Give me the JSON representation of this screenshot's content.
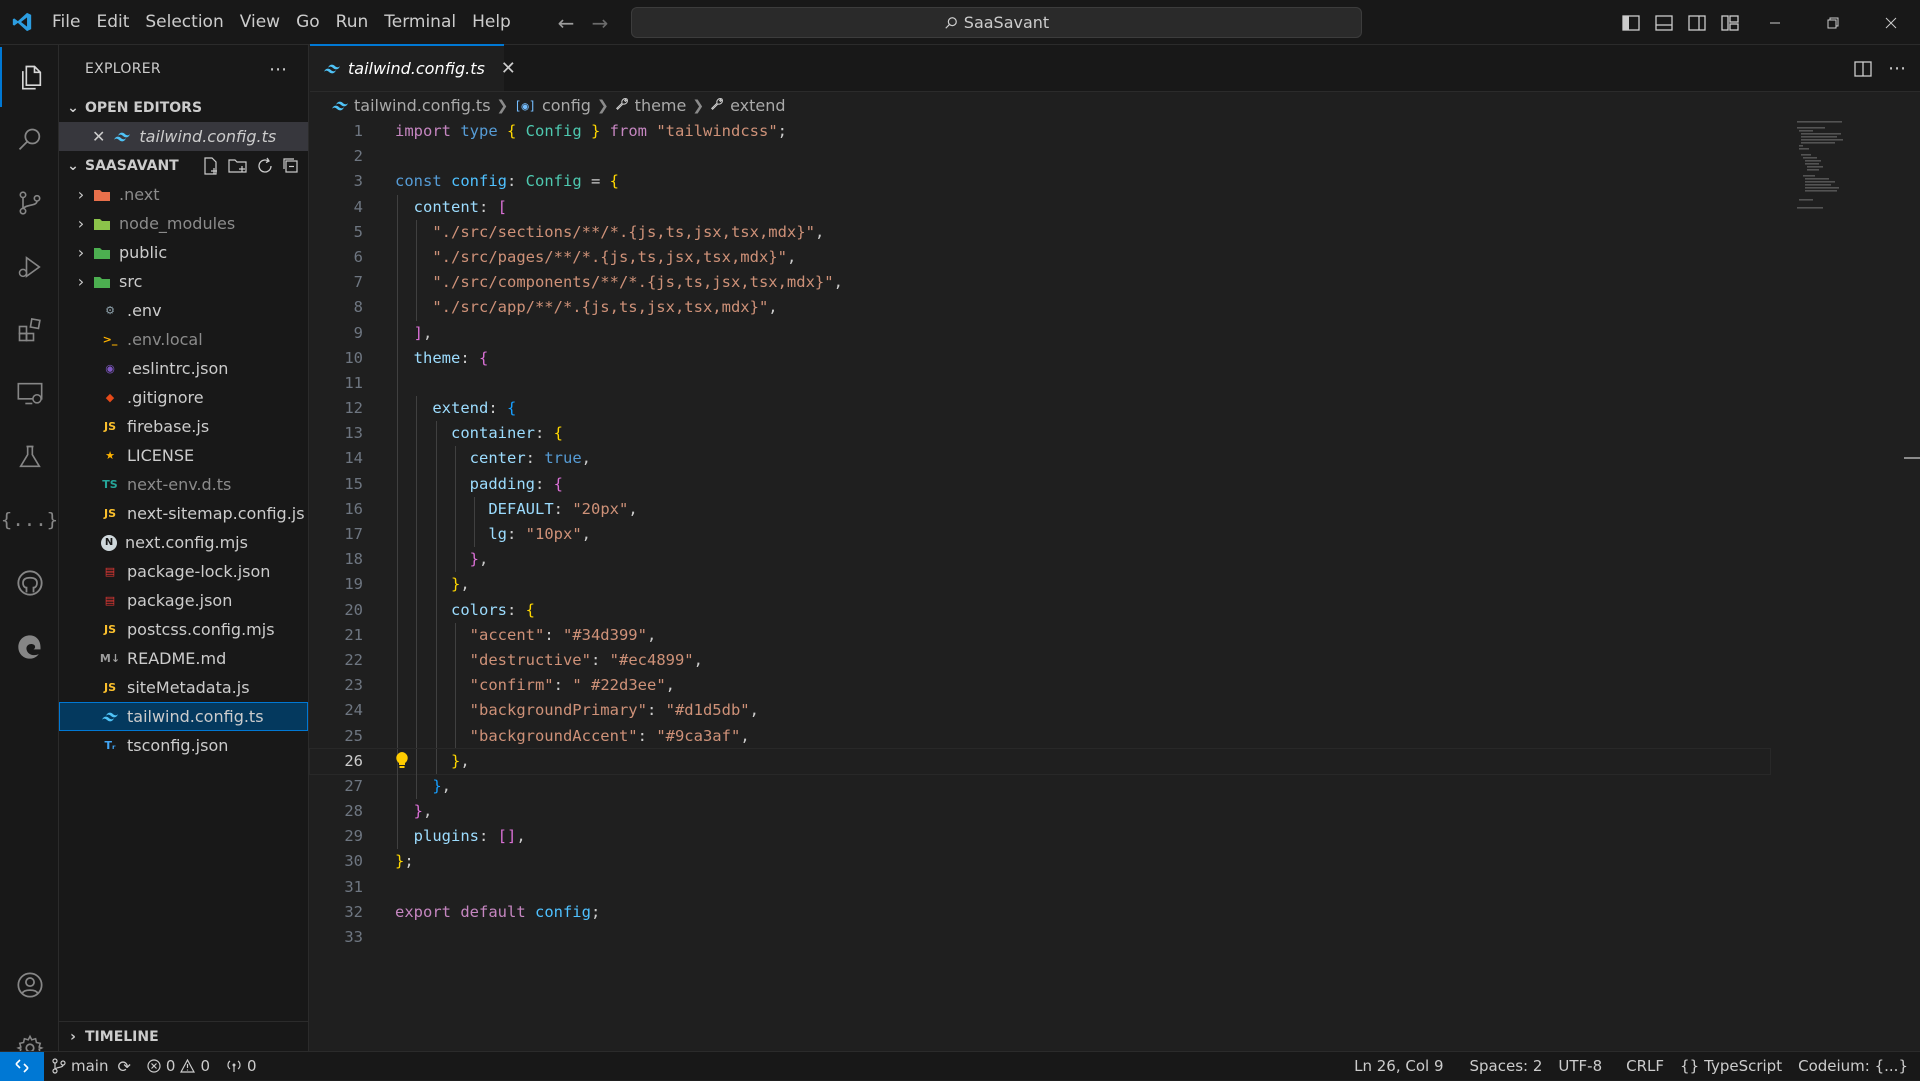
{
  "menu": [
    "File",
    "Edit",
    "Selection",
    "View",
    "Go",
    "Run",
    "Terminal",
    "Help"
  ],
  "search": {
    "text": "SaaSavant"
  },
  "sidebar": {
    "title": "EXPLORER",
    "open_editors_label": "OPEN EDITORS",
    "open_editor_file": "tailwind.config.ts",
    "project_label": "SAASAVANT",
    "timeline_label": "TIMELINE",
    "files": [
      {
        "name": ".next",
        "kind": "folder",
        "icon": "next-folder-icon",
        "color": "#e8704b"
      },
      {
        "name": "node_modules",
        "kind": "folder",
        "icon": "node-folder-icon",
        "color": "#8bc34a"
      },
      {
        "name": "public",
        "kind": "folder",
        "icon": "public-folder-icon",
        "color": "#4caf50"
      },
      {
        "name": "src",
        "kind": "folder",
        "icon": "src-folder-icon",
        "color": "#4caf50"
      },
      {
        "name": ".env",
        "kind": "file",
        "icon": "gear-icon",
        "color": "#90a4ae"
      },
      {
        "name": ".env.local",
        "kind": "file",
        "icon": "terminal-file-icon",
        "color": "#ffb300"
      },
      {
        "name": ".eslintrc.json",
        "kind": "file",
        "icon": "eslint-icon",
        "color": "#7e57c2"
      },
      {
        "name": ".gitignore",
        "kind": "file",
        "icon": "git-icon",
        "color": "#e64a19"
      },
      {
        "name": "firebase.js",
        "kind": "file",
        "icon": "js-icon",
        "color": "#fbc02d"
      },
      {
        "name": "LICENSE",
        "kind": "file",
        "icon": "license-icon",
        "color": "#ffb300"
      },
      {
        "name": "next-env.d.ts",
        "kind": "file",
        "icon": "ts-icon",
        "color": "#26a69a"
      },
      {
        "name": "next-sitemap.config.js",
        "kind": "file",
        "icon": "js-icon",
        "color": "#fbc02d"
      },
      {
        "name": "next.config.mjs",
        "kind": "file",
        "icon": "next-icon",
        "color": "#cfd8dc"
      },
      {
        "name": "package-lock.json",
        "kind": "file",
        "icon": "npm-icon",
        "color": "#e53935"
      },
      {
        "name": "package.json",
        "kind": "file",
        "icon": "npm-icon",
        "color": "#e53935"
      },
      {
        "name": "postcss.config.mjs",
        "kind": "file",
        "icon": "js-icon",
        "color": "#fbc02d"
      },
      {
        "name": "README.md",
        "kind": "file",
        "icon": "markdown-icon",
        "color": "#9e9e9e"
      },
      {
        "name": "siteMetadata.js",
        "kind": "file",
        "icon": "js-icon",
        "color": "#fbc02d"
      },
      {
        "name": "tailwind.config.ts",
        "kind": "file",
        "icon": "tailwind-icon",
        "color": "#4fc3f7",
        "selected": true
      },
      {
        "name": "tsconfig.json",
        "kind": "file",
        "icon": "tsconfig-icon",
        "color": "#42a5f5"
      }
    ]
  },
  "editor": {
    "tab_label": "tailwind.config.ts",
    "breadcrumb": [
      "tailwind.config.ts",
      "config",
      "theme",
      "extend"
    ],
    "current_line": 26
  },
  "statusbar": {
    "branch": "main",
    "errors": "0",
    "warnings": "0",
    "ports": "0",
    "position": "Ln 26, Col 9",
    "spaces": "Spaces: 2",
    "encoding": "UTF-8",
    "eol": "CRLF",
    "language": "TypeScript",
    "codeium": "Codeium: {...}"
  },
  "code_lines": [
    [
      [
        "kw2",
        "import "
      ],
      [
        "kw",
        "type "
      ],
      [
        "b1",
        "{ "
      ],
      [
        "ty",
        "Config "
      ],
      [
        "b1",
        "} "
      ],
      [
        "kw2",
        "from "
      ],
      [
        "str",
        "\"tailwindcss\""
      ],
      [
        "pun",
        ";"
      ]
    ],
    [],
    [
      [
        "kw",
        "const "
      ],
      [
        "var",
        "config"
      ],
      [
        "pun",
        ": "
      ],
      [
        "ty",
        "Config "
      ],
      [
        "pun",
        "= "
      ],
      [
        "b1",
        "{"
      ]
    ],
    [
      [
        "pun",
        "  "
      ],
      [
        "prop",
        "content"
      ],
      [
        "pun",
        ": "
      ],
      [
        "b2",
        "["
      ]
    ],
    [
      [
        "pun",
        "    "
      ],
      [
        "str",
        "\"./src/sections/**/*.{js,ts,jsx,tsx,mdx}\""
      ],
      [
        "pun",
        ","
      ]
    ],
    [
      [
        "pun",
        "    "
      ],
      [
        "str",
        "\"./src/pages/**/*.{js,ts,jsx,tsx,mdx}\""
      ],
      [
        "pun",
        ","
      ]
    ],
    [
      [
        "pun",
        "    "
      ],
      [
        "str",
        "\"./src/components/**/*.{js,ts,jsx,tsx,mdx}\""
      ],
      [
        "pun",
        ","
      ]
    ],
    [
      [
        "pun",
        "    "
      ],
      [
        "str",
        "\"./src/app/**/*.{js,ts,jsx,tsx,mdx}\""
      ],
      [
        "pun",
        ","
      ]
    ],
    [
      [
        "pun",
        "  "
      ],
      [
        "b2",
        "]"
      ],
      [
        "pun",
        ","
      ]
    ],
    [
      [
        "pun",
        "  "
      ],
      [
        "prop",
        "theme"
      ],
      [
        "pun",
        ": "
      ],
      [
        "b2",
        "{"
      ]
    ],
    [],
    [
      [
        "pun",
        "    "
      ],
      [
        "prop",
        "extend"
      ],
      [
        "pun",
        ": "
      ],
      [
        "b3",
        "{"
      ]
    ],
    [
      [
        "pun",
        "      "
      ],
      [
        "prop",
        "container"
      ],
      [
        "pun",
        ": "
      ],
      [
        "b1",
        "{"
      ]
    ],
    [
      [
        "pun",
        "        "
      ],
      [
        "prop",
        "center"
      ],
      [
        "pun",
        ": "
      ],
      [
        "kw",
        "true"
      ],
      [
        "pun",
        ","
      ]
    ],
    [
      [
        "pun",
        "        "
      ],
      [
        "prop",
        "padding"
      ],
      [
        "pun",
        ": "
      ],
      [
        "b2",
        "{"
      ]
    ],
    [
      [
        "pun",
        "          "
      ],
      [
        "prop",
        "DEFAULT"
      ],
      [
        "pun",
        ": "
      ],
      [
        "str",
        "\"20px\""
      ],
      [
        "pun",
        ","
      ]
    ],
    [
      [
        "pun",
        "          "
      ],
      [
        "prop",
        "lg"
      ],
      [
        "pun",
        ": "
      ],
      [
        "str",
        "\"10px\""
      ],
      [
        "pun",
        ","
      ]
    ],
    [
      [
        "pun",
        "        "
      ],
      [
        "b2",
        "}"
      ],
      [
        "pun",
        ","
      ]
    ],
    [
      [
        "pun",
        "      "
      ],
      [
        "b1",
        "}"
      ],
      [
        "pun",
        ","
      ]
    ],
    [
      [
        "pun",
        "      "
      ],
      [
        "prop",
        "colors"
      ],
      [
        "pun",
        ": "
      ],
      [
        "b1",
        "{"
      ]
    ],
    [
      [
        "pun",
        "        "
      ],
      [
        "str",
        "\"accent\""
      ],
      [
        "pun",
        ": "
      ],
      [
        "str",
        "\"#34d399\""
      ],
      [
        "pun",
        ","
      ]
    ],
    [
      [
        "pun",
        "        "
      ],
      [
        "str",
        "\"destructive\""
      ],
      [
        "pun",
        ": "
      ],
      [
        "str",
        "\"#ec4899\""
      ],
      [
        "pun",
        ","
      ]
    ],
    [
      [
        "pun",
        "        "
      ],
      [
        "str",
        "\"confirm\""
      ],
      [
        "pun",
        ": "
      ],
      [
        "str",
        "\" #22d3ee\""
      ],
      [
        "pun",
        ","
      ]
    ],
    [
      [
        "pun",
        "        "
      ],
      [
        "str",
        "\"backgroundPrimary\""
      ],
      [
        "pun",
        ": "
      ],
      [
        "str",
        "\"#d1d5db\""
      ],
      [
        "pun",
        ","
      ]
    ],
    [
      [
        "pun",
        "        "
      ],
      [
        "str",
        "\"backgroundAccent\""
      ],
      [
        "pun",
        ": "
      ],
      [
        "str",
        "\"#9ca3af\""
      ],
      [
        "pun",
        ","
      ]
    ],
    [
      [
        "pun",
        "      "
      ],
      [
        "b1",
        "}"
      ],
      [
        "pun",
        ","
      ]
    ],
    [
      [
        "pun",
        "    "
      ],
      [
        "b3",
        "}"
      ],
      [
        "pun",
        ","
      ]
    ],
    [
      [
        "pun",
        "  "
      ],
      [
        "b2",
        "}"
      ],
      [
        "pun",
        ","
      ]
    ],
    [
      [
        "pun",
        "  "
      ],
      [
        "prop",
        "plugins"
      ],
      [
        "pun",
        ": "
      ],
      [
        "b2",
        "[]"
      ],
      [
        "pun",
        ","
      ]
    ],
    [
      [
        "b1",
        "}"
      ],
      [
        "pun",
        ";"
      ]
    ],
    [],
    [
      [
        "kw2",
        "export "
      ],
      [
        "kw2",
        "default "
      ],
      [
        "var",
        "config"
      ],
      [
        "pun",
        ";"
      ]
    ],
    []
  ],
  "code_indents": [
    0,
    0,
    0,
    1,
    2,
    2,
    2,
    2,
    1,
    1,
    1,
    2,
    3,
    4,
    4,
    5,
    5,
    4,
    3,
    3,
    4,
    4,
    4,
    4,
    4,
    3,
    2,
    1,
    1,
    0,
    0,
    0,
    0
  ]
}
